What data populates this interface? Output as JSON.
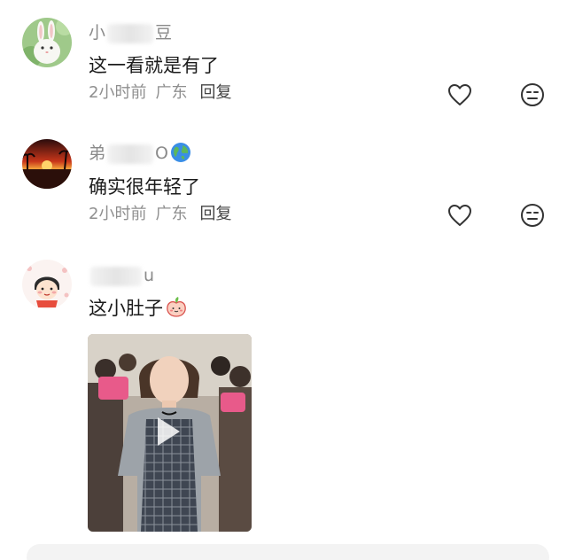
{
  "comments": [
    {
      "user_start": "小",
      "user_end": "豆",
      "text": "这一看就是有了",
      "time": "2小时前",
      "location": "广东",
      "reply_label": "回复"
    },
    {
      "user_start": "弟",
      "user_end": "O",
      "text": "确实很年轻了",
      "time": "2小时前",
      "location": "广东",
      "reply_label": "回复"
    },
    {
      "user_start": "",
      "user_end": "u",
      "text": "这小肚子",
      "time": "",
      "location": "",
      "reply_label": ""
    }
  ],
  "colors": {
    "meta": "#8f8f8f",
    "text": "#1b1b1b",
    "icon": "#333333"
  },
  "icons": [
    "like-heart-icon",
    "dislike-face-icon",
    "globe-emoji-icon",
    "peach-emoji-icon",
    "play-icon"
  ]
}
